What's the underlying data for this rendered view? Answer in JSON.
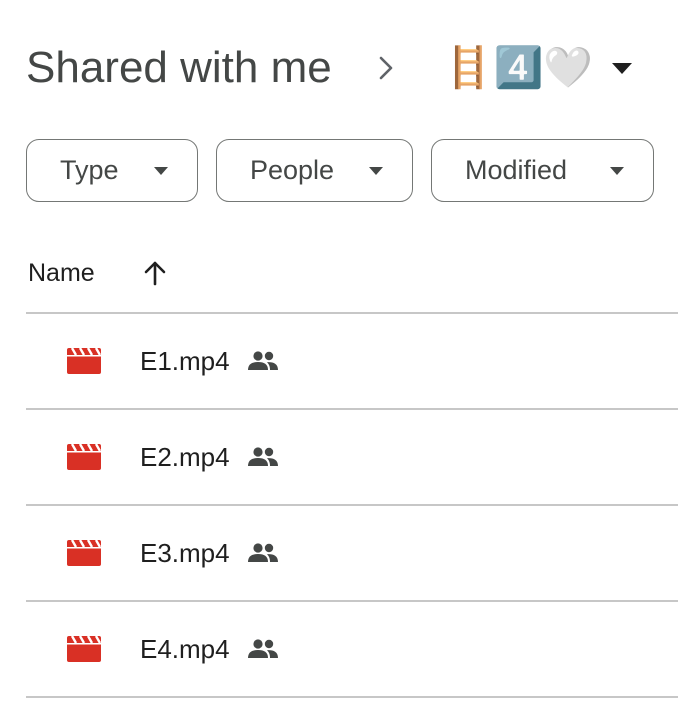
{
  "breadcrumb": {
    "root": "Shared with me",
    "current": "🪜4️⃣🤍"
  },
  "filters": [
    {
      "label": "Type"
    },
    {
      "label": "People"
    },
    {
      "label": "Modified"
    }
  ],
  "list_header": {
    "name_column": "Name"
  },
  "files": [
    {
      "name": "E1.mp4"
    },
    {
      "name": "E2.mp4"
    },
    {
      "name": "E3.mp4"
    },
    {
      "name": "E4.mp4"
    }
  ],
  "colors": {
    "video_icon": "#d93025",
    "text_primary": "#1f1f1f",
    "text_secondary": "#444746",
    "border": "#747775",
    "divider": "#c7c7c7"
  }
}
